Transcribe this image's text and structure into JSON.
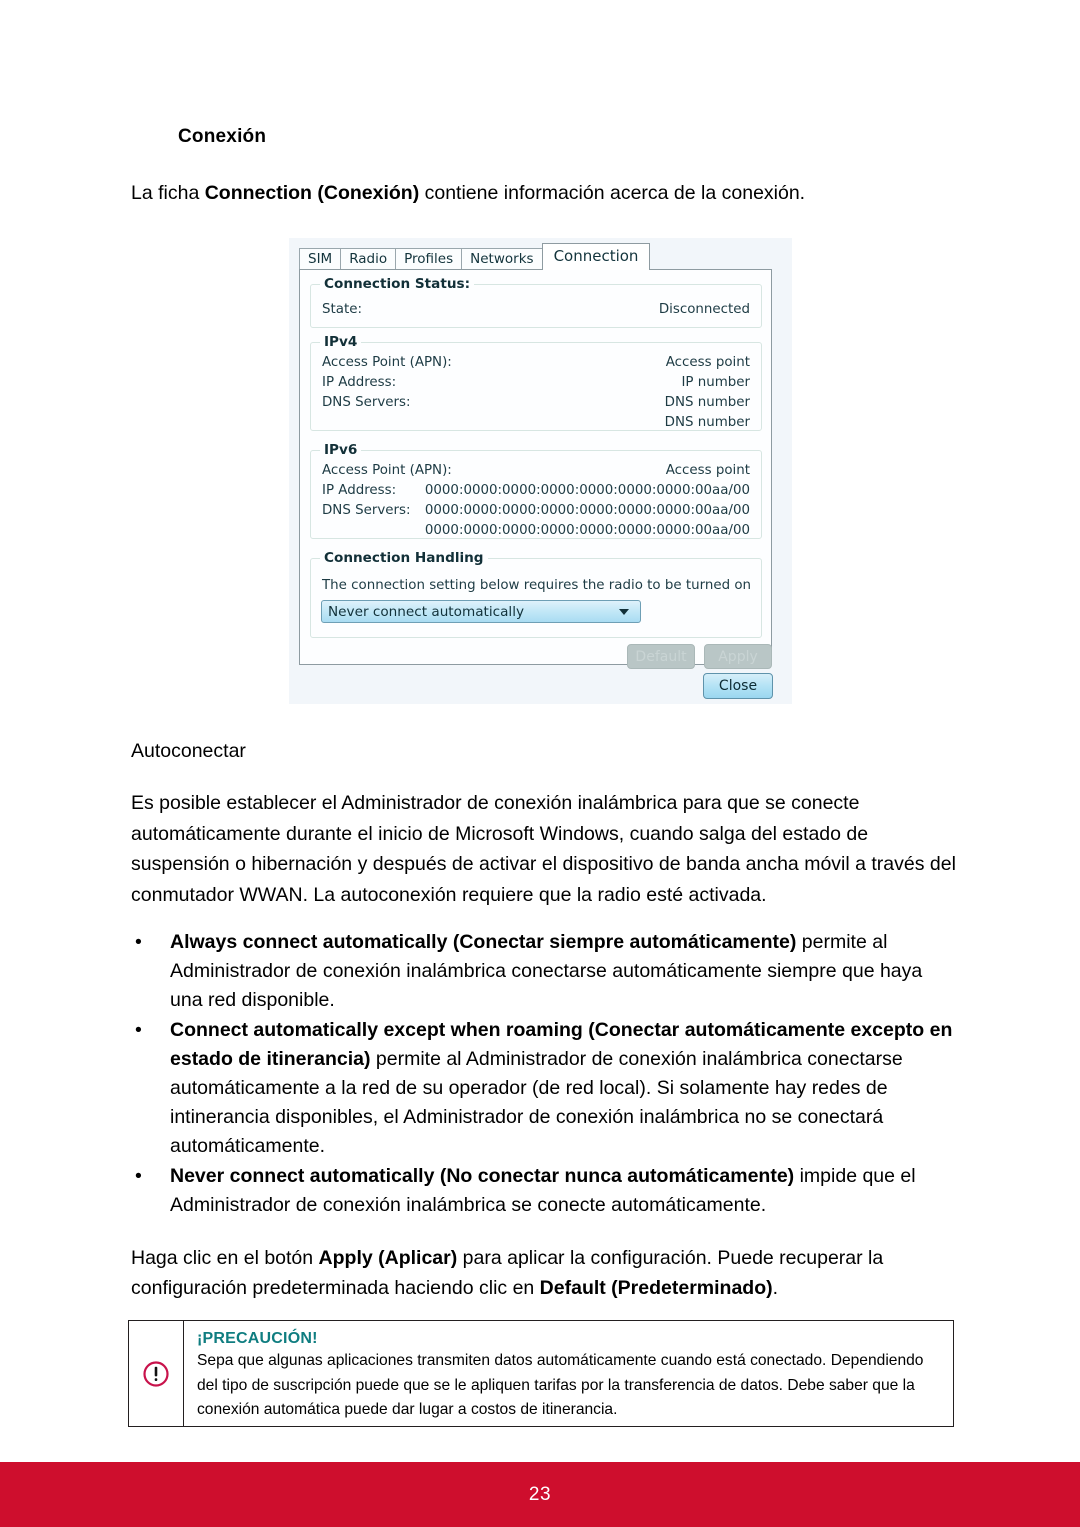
{
  "document": {
    "section_heading": "Conexión",
    "intro_before": "La ficha ",
    "intro_bold": "Connection (Conexión)",
    "intro_after": " contiene información acerca de la conexión.",
    "autoconnect_title": "Autoconectar",
    "autoconnect_paragraph": "Es posible establecer el Administrador de conexión inalámbrica para que se conecte automáticamente durante el inicio de Microsoft Windows, cuando salga del estado de suspensión o hibernación y después de activar el dispositivo de banda ancha móvil a través del conmutador WWAN. La autoconexión requiere que la radio esté activada.",
    "bullet_marker": "•",
    "bullets": [
      {
        "bold": "Always connect automatically (Conectar siempre automáticamente)",
        "rest": " permite al Administrador de conexión inalámbrica conectarse automáticamente siempre que haya una red disponible."
      },
      {
        "bold": "Connect automatically except when roaming (Conectar automáticamente excepto en estado de itinerancia)",
        "rest": " permite al Administrador de conexión inalámbrica conectarse automáticamente a la red de su operador (de red local). Si solamente hay redes de intinerancia disponibles, el Administrador de conexión inalámbrica no se conectará automáticamente."
      },
      {
        "bold": "Never connect automatically (No conectar nunca automáticamente)",
        "rest": " impide que el Administrador de conexión inalámbrica se conecte automáticamente."
      }
    ],
    "apply_paragraph": {
      "part1": "Haga clic en el botón ",
      "bold1": "Apply (Aplicar)",
      "part2": " para aplicar la configuración. Puede recuperar la configuración predeterminada haciendo clic en ",
      "bold2": "Default (Predeterminado)",
      "part3": "."
    },
    "caution": {
      "icon": "exclamation-circle-icon",
      "title": "¡PRECAUCIÓN!",
      "text": "Sepa que algunas aplicaciones transmiten datos automáticamente cuando está conectado. Dependiendo del tipo de suscripción puede que se le apliquen tarifas por la transferencia de datos. Debe saber que la conexión automática puede dar lugar a costos de itinerancia.",
      "title_color": "#0f7d80",
      "icon_color": "#c8124b"
    },
    "footer": {
      "page_number": "23",
      "bar_color": "#ce0e2d"
    }
  },
  "dialog": {
    "tabs": [
      {
        "label": "SIM",
        "active": false
      },
      {
        "label": "Radio",
        "active": false
      },
      {
        "label": "Profiles",
        "active": false
      },
      {
        "label": "Networks",
        "active": false
      },
      {
        "label": "Connection",
        "active": true
      }
    ],
    "connection_status": {
      "title": "Connection Status:",
      "rows": [
        {
          "label": "State:",
          "value": "Disconnected"
        }
      ]
    },
    "ipv4": {
      "title": "IPv4",
      "rows": [
        {
          "label": "Access Point (APN):",
          "value": "Access point"
        },
        {
          "label": "IP Address:",
          "value": "IP number"
        },
        {
          "label": "DNS Servers:",
          "value": "DNS number"
        },
        {
          "label": "",
          "value": "DNS number"
        }
      ]
    },
    "ipv6": {
      "title": "IPv6",
      "rows": [
        {
          "label": "Access Point (APN):",
          "value": "Access point"
        },
        {
          "label": "IP Address:",
          "value": "0000:0000:0000:0000:0000:0000:0000:00aa/00"
        },
        {
          "label": "DNS Servers:",
          "value": "0000:0000:0000:0000:0000:0000:0000:00aa/00"
        },
        {
          "label": "",
          "value": "0000:0000:0000:0000:0000:0000:0000:00aa/00"
        }
      ]
    },
    "connection_handling": {
      "title": "Connection Handling",
      "note": "The connection setting below requires the radio to be turned on",
      "dropdown_value": "Never connect automatically",
      "dropdown_icon": "chevron-down-icon"
    },
    "buttons": {
      "default_label": "Default",
      "apply_label": "Apply",
      "close_label": "Close"
    }
  }
}
